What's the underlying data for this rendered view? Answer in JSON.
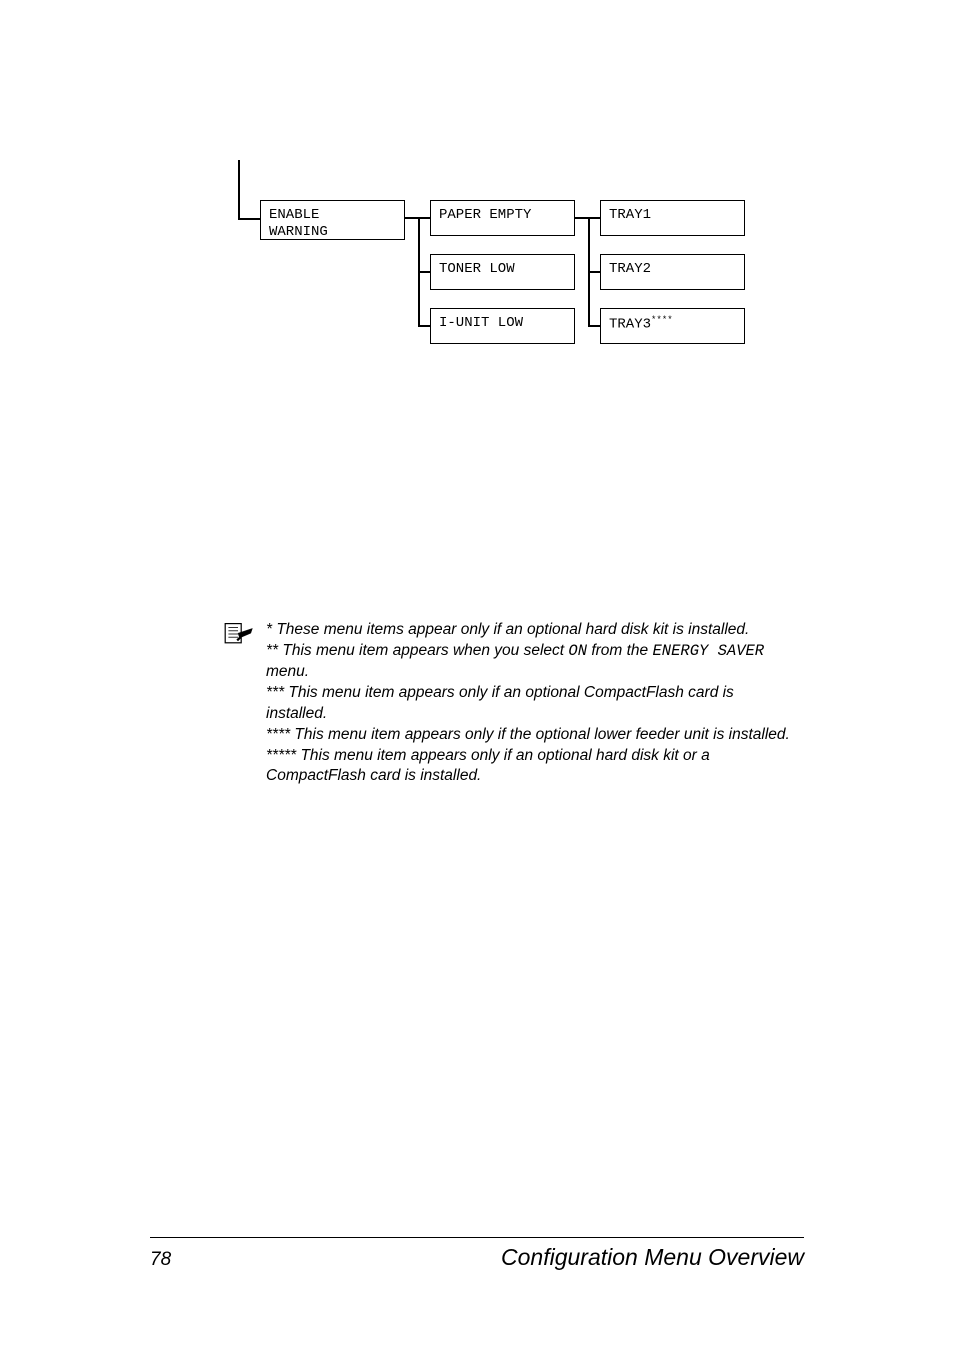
{
  "diagram": {
    "enable_warning": "ENABLE\nWARNING",
    "paper_empty": "PAPER EMPTY",
    "toner_low": "TONER LOW",
    "iunit_low": "I-UNIT LOW",
    "tray1": "TRAY1",
    "tray2": "TRAY2",
    "tray3": "TRAY3",
    "tray3_suffix": "****"
  },
  "notes": {
    "line1_a": "* These menu items appear only if an optional hard disk kit is installed.",
    "line2_a": "** This menu item appears when you select ",
    "line2_on": "ON",
    "line2_b": " from the ",
    "line2_energy": "ENERGY SAVER",
    "line2_c": " menu.",
    "line3": "*** This menu item appears only if an optional CompactFlash card is installed.",
    "line4": "**** This menu item appears only if the optional lower feeder unit is installed.",
    "line5": "***** This menu item appears only if an optional hard disk kit or a CompactFlash card is installed."
  },
  "footer": {
    "page_number": "78",
    "title": "Configuration Menu Overview"
  }
}
